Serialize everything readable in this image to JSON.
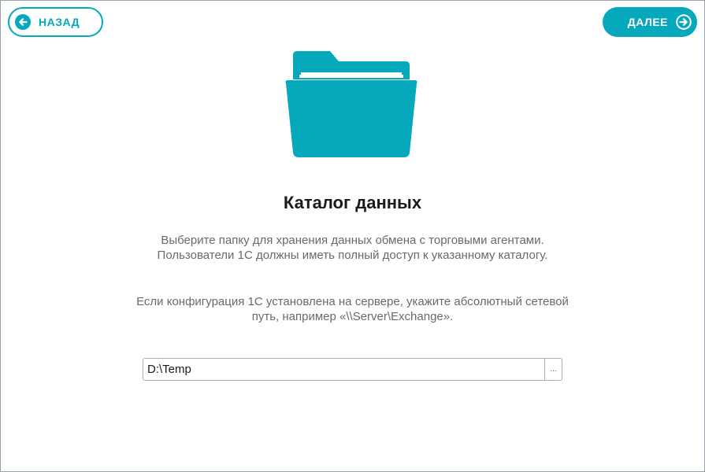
{
  "nav": {
    "back_label": "НАЗАД",
    "next_label": "ДАЛЕЕ"
  },
  "content": {
    "title": "Каталог данных",
    "description_1": "Выберите папку для хранения данных обмена с торговыми агентами. Пользователи 1С должны иметь полный доступ к указанному каталогу.",
    "description_2": "Если конфигурация 1С установлена на сервере, укажите абсолютный сетевой путь, например «\\\\Server\\Exchange»."
  },
  "path_field": {
    "value": "D:\\Temp",
    "browse_label": "..."
  },
  "icons": {
    "back": "arrow-left-circle-icon",
    "next": "arrow-right-circle-icon",
    "folder": "folder-open-icon"
  },
  "colors": {
    "accent": "#06a9bb",
    "title_text": "#1b1b1b",
    "description_text": "#666a70",
    "border": "#a9aeb4"
  }
}
